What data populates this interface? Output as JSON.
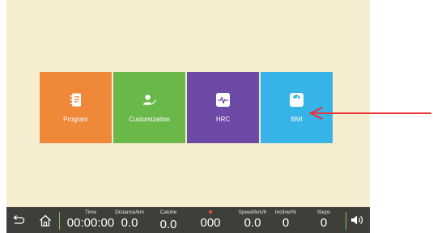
{
  "tiles": [
    {
      "label": "Program",
      "icon": "notebook-icon",
      "color": "#f0883a"
    },
    {
      "label": "Customization",
      "icon": "user-edit-icon",
      "color": "#6ab84a"
    },
    {
      "label": "HRC",
      "icon": "heart-pulse-icon",
      "color": "#6c4aa6"
    },
    {
      "label": "BMI",
      "icon": "scale-icon",
      "color": "#36b3e7"
    }
  ],
  "metrics": {
    "time": {
      "label": "Time",
      "value": "00:00:00"
    },
    "distance": {
      "label": "Distance/km",
      "value": "0.0"
    },
    "calorie": {
      "label": "Calorie",
      "value": "0.0"
    },
    "heart_rate": {
      "label": "♥",
      "value": "000"
    },
    "speed": {
      "label": "Speed/km/h",
      "value": "0.0"
    },
    "incline": {
      "label": "Incline/%",
      "value": "0"
    },
    "steps": {
      "label": "Steps",
      "value": "0"
    }
  },
  "colors": {
    "background": "#f5edcf",
    "bottom_bar": "#3e3f3b",
    "divider": "#7fc24f",
    "annotation_arrow": "#e8333a"
  }
}
